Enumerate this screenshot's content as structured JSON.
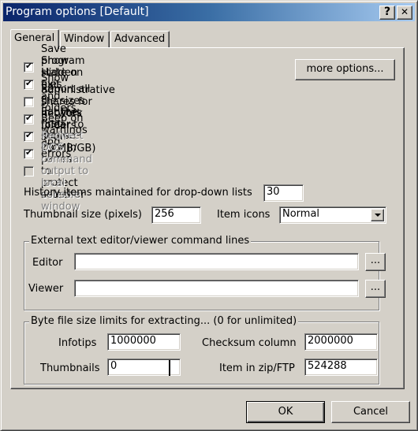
{
  "window": {
    "title": "Program options [Default]",
    "help_button": "?",
    "close_button": "✕"
  },
  "tabs": [
    {
      "label": "General",
      "active": true
    },
    {
      "label": "Window",
      "active": false
    },
    {
      "label": "Advanced",
      "active": false
    }
  ],
  "options": [
    {
      "label": "Save program state on exit",
      "checked": true,
      "enabled": true
    },
    {
      "label": "Show Hidden files and folders",
      "checked": true,
      "enabled": true
    },
    {
      "label": "Show administrative shares for network folders",
      "checked": false,
      "enabled": true
    },
    {
      "label": "Report all file sizes in bytes (clear to show kB/MB/GB)",
      "checked": true,
      "enabled": true
    },
    {
      "label": "Beep on warnings and errors",
      "checked": true,
      "enabled": true
    },
    {
      "label": "Eat the first mouse click in panes to protect selectior",
      "checked": true,
      "enabled": true
    },
    {
      "label": "Redirect DOS command output to local console window",
      "checked": false,
      "enabled": false
    }
  ],
  "more_options_button": "more options...",
  "history": {
    "label": "History items maintained for drop-down lists",
    "value": "30"
  },
  "thumbnail_size": {
    "label": "Thumbnail size (pixels)",
    "value": "256"
  },
  "item_icons": {
    "label": "Item icons",
    "value": "Normal"
  },
  "external_editor": {
    "group_title": "External text editor/viewer command lines",
    "editor_label": "Editor",
    "editor_value": "",
    "viewer_label": "Viewer",
    "viewer_value": "",
    "browse_label": "..."
  },
  "byte_limits": {
    "group_title": "Byte file size limits for extracting... (0 for unlimited)",
    "infotips_label": "Infotips",
    "infotips_value": "1000000",
    "checksum_label": "Checksum column",
    "checksum_value": "2000000",
    "thumbnails_label": "Thumbnails",
    "thumbnails_value": "0",
    "zip_label": "Item in zip/FTP",
    "zip_value": "524288"
  },
  "footer": {
    "ok_label": "OK",
    "cancel_label": "Cancel"
  }
}
